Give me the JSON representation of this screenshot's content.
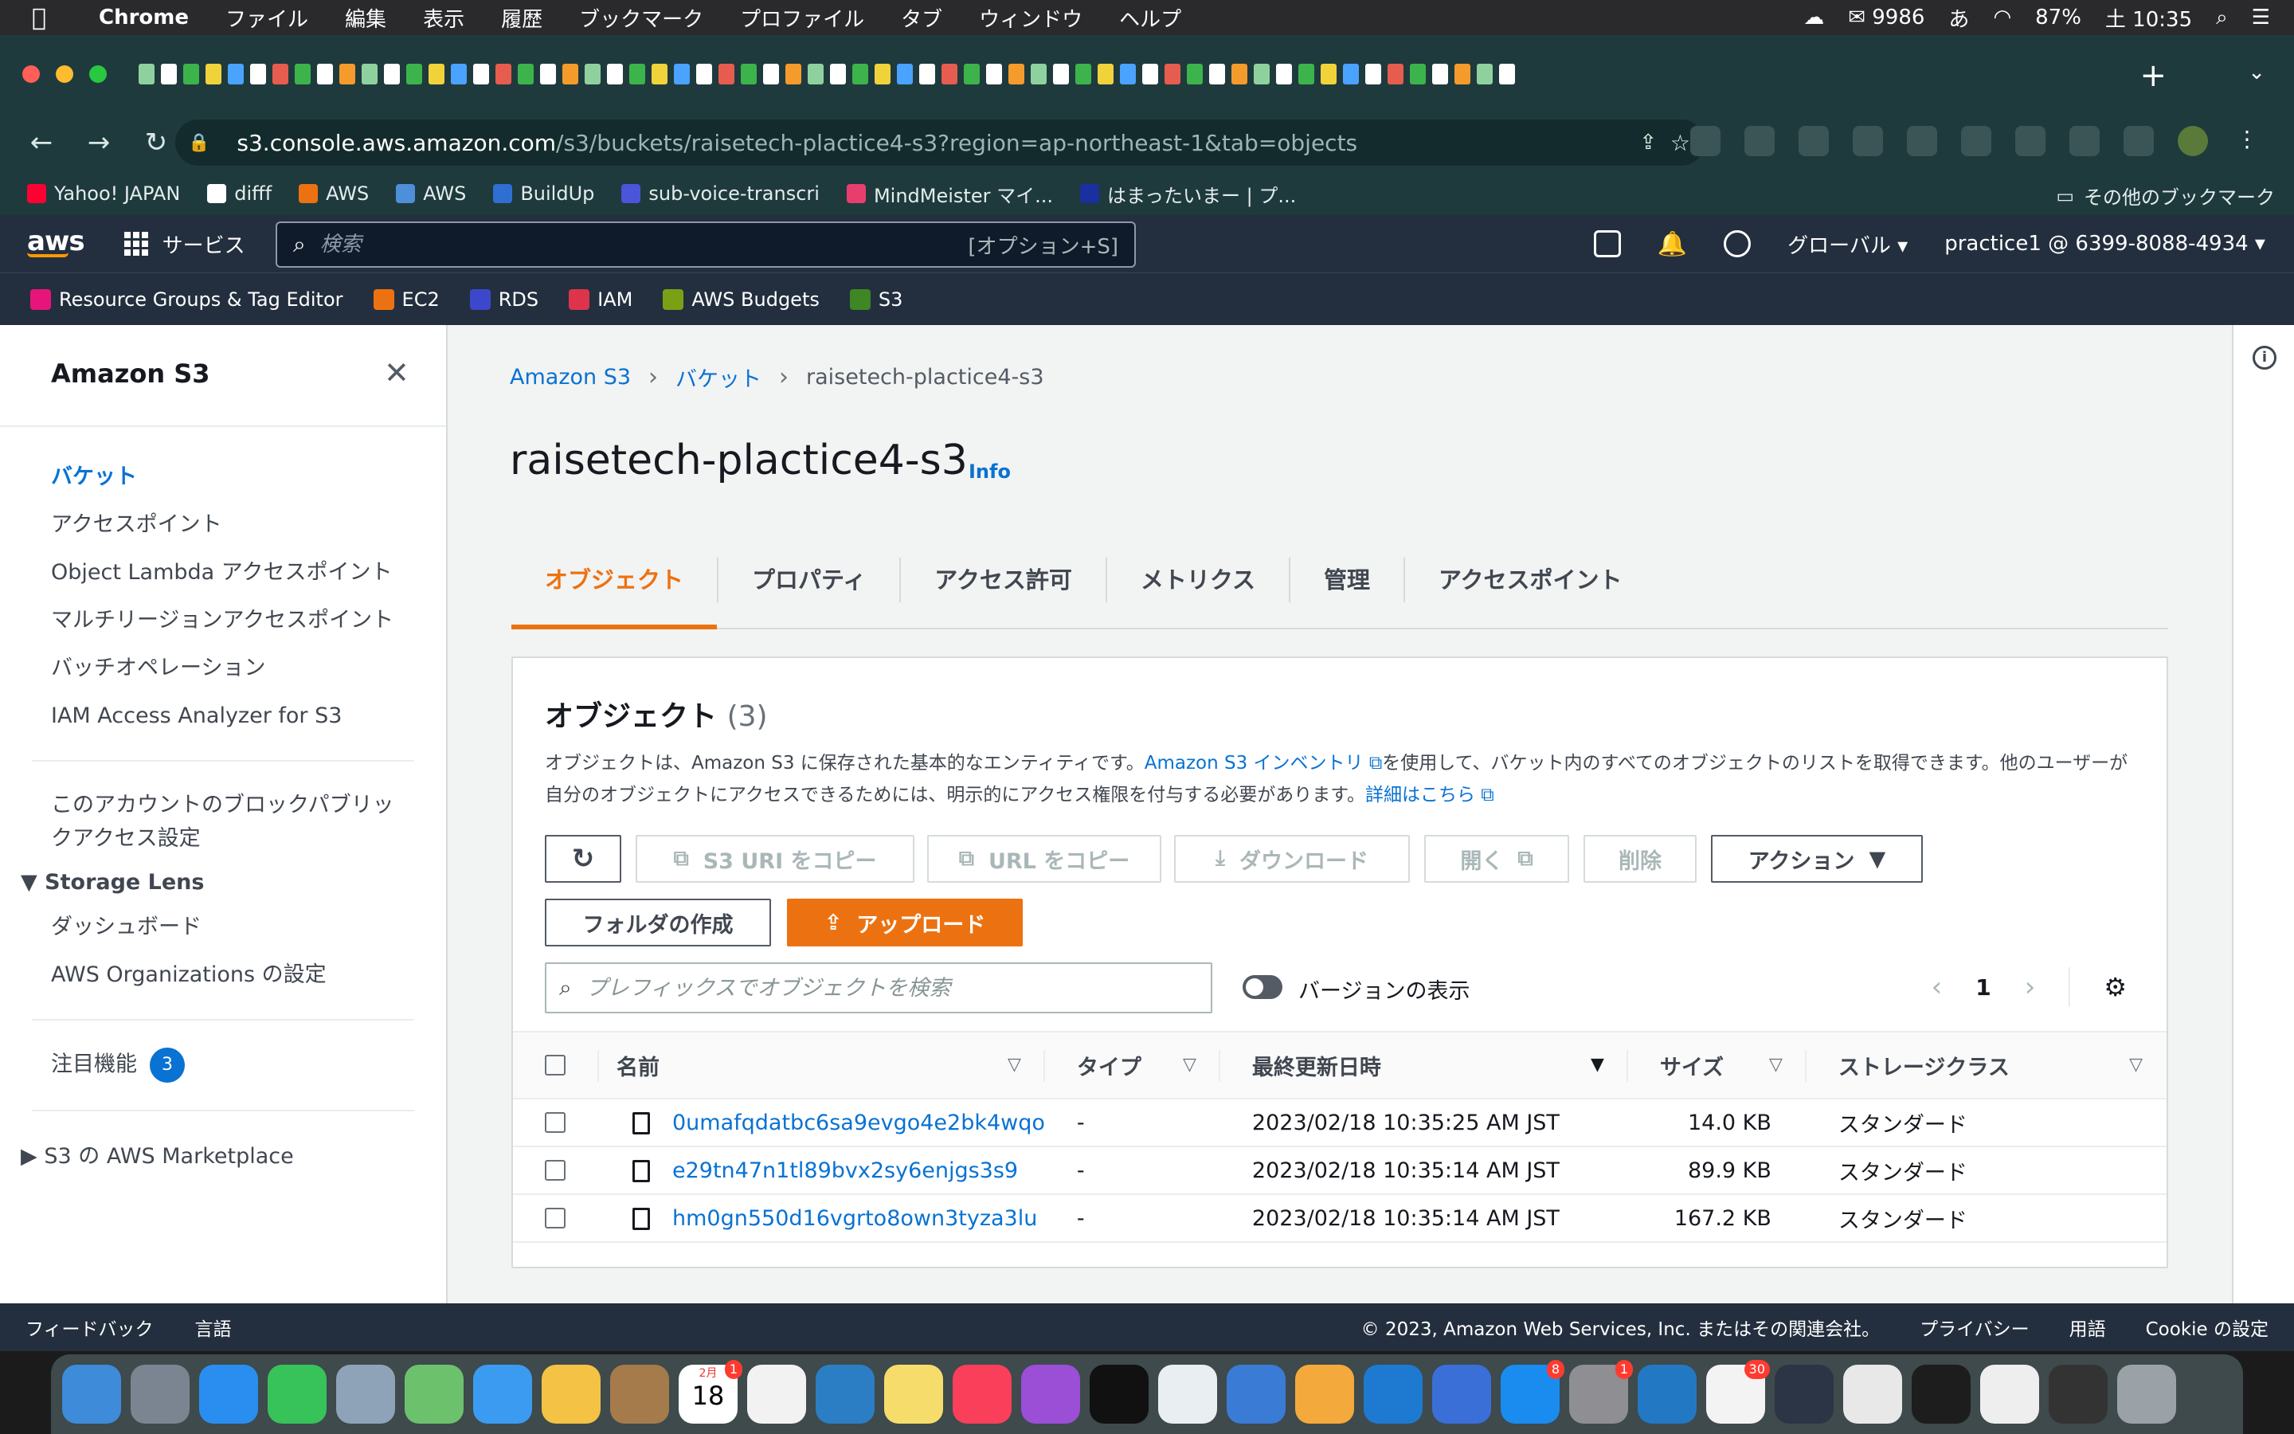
{
  "macos_menubar": {
    "app": "Chrome",
    "menus": [
      "ファイル",
      "編集",
      "表示",
      "履歴",
      "ブックマーク",
      "プロファイル",
      "タブ",
      "ウィンドウ",
      "ヘルプ"
    ],
    "status": {
      "mail_count": "9986",
      "input_method": "あ",
      "battery": "87%",
      "clock": "土 10:35"
    }
  },
  "browser": {
    "url_host": "s3.console.aws.amazon.com",
    "url_path": "/s3/buckets/raisetech-plactice4-s3?region=ap-northeast-1&tab=objects",
    "new_tab": "+",
    "bookmarks": [
      {
        "label": "Yahoo! JAPAN",
        "color": "#ff0033"
      },
      {
        "label": "difff",
        "color": "#ffffff"
      },
      {
        "label": "AWS",
        "color": "#ec7211"
      },
      {
        "label": "AWS",
        "color": "#4d8fd8"
      },
      {
        "label": "BuildUp",
        "color": "#2f6fd1"
      },
      {
        "label": "sub-voice-transcri",
        "color": "#4b55d9"
      },
      {
        "label": "MindMeister マイ...",
        "color": "#e83e6e"
      },
      {
        "label": "はまったいまー | プ...",
        "color": "#1a2fa0"
      }
    ],
    "other_bookmarks": "その他のブックマーク"
  },
  "aws_header": {
    "logo": "aws",
    "services": "サービス",
    "search_placeholder": "検索",
    "search_shortcut": "[オプション+S]",
    "region": "グローバル",
    "account": "practice1 @ 6399-8088-4934",
    "favorites": [
      {
        "label": "Resource Groups & Tag Editor",
        "color": "#e7157b"
      },
      {
        "label": "EC2",
        "color": "#ec7211"
      },
      {
        "label": "RDS",
        "color": "#3b48cc"
      },
      {
        "label": "IAM",
        "color": "#dd344c"
      },
      {
        "label": "AWS Budgets",
        "color": "#7aa116"
      },
      {
        "label": "S3",
        "color": "#3f8624"
      }
    ]
  },
  "sidebar": {
    "title": "Amazon S3",
    "items": [
      "バケット",
      "アクセスポイント",
      "Object Lambda アクセスポイント",
      "マルチリージョンアクセスポイント",
      "バッチオペレーション",
      "IAM Access Analyzer for S3"
    ],
    "block_public": "このアカウントのブロックパブリックアクセス設定",
    "storage_lens": "Storage Lens",
    "storage_items": [
      "ダッシュボード",
      "AWS Organizations の設定"
    ],
    "featured": "注目機能",
    "featured_count": "3",
    "marketplace": "S3 の AWS Marketplace"
  },
  "main": {
    "breadcrumbs": [
      "Amazon S3",
      "バケット",
      "raisetech-plactice4-s3"
    ],
    "title": "raisetech-plactice4-s3",
    "info": "Info",
    "tabs": [
      "オブジェクト",
      "プロパティ",
      "アクセス許可",
      "メトリクス",
      "管理",
      "アクセスポイント"
    ],
    "objects": {
      "heading": "オブジェクト",
      "count": "(3)",
      "desc_1": "オブジェクトは、Amazon S3 に保存された基本的なエンティティです。",
      "desc_link": "Amazon S3 インベントリ",
      "desc_2": "を使用して、バケット内のすべてのオブジェクトのリストを取得できます。他のユーザーが自分のオブジェクトにアクセスできるためには、明示的にアクセス権限を付与する必要があります。",
      "desc_link2": "詳細はこちら",
      "buttons": {
        "copy_uri": "S3 URI をコピー",
        "copy_url": "URL をコピー",
        "download": "ダウンロード",
        "open": "開く",
        "delete": "削除",
        "actions": "アクション",
        "create_folder": "フォルダの作成",
        "upload": "アップロード"
      },
      "search_placeholder": "プレフィックスでオブジェクトを検索",
      "versions": "バージョンの表示",
      "page": "1",
      "columns": [
        "名前",
        "タイプ",
        "最終更新日時",
        "サイズ",
        "ストレージクラス"
      ],
      "rows": [
        {
          "name": "0umafqdatbc6sa9evgo4e2bk4wqo",
          "type": "-",
          "modified": "2023/02/18 10:35:25 AM JST",
          "size": "14.0 KB",
          "class": "スタンダード"
        },
        {
          "name": "e29tn47n1tl89bvx2sy6enjgs3s9",
          "type": "-",
          "modified": "2023/02/18 10:35:14 AM JST",
          "size": "89.9 KB",
          "class": "スタンダード"
        },
        {
          "name": "hm0gn550d16vgrto8own3tyza3lu",
          "type": "-",
          "modified": "2023/02/18 10:35:14 AM JST",
          "size": "167.2 KB",
          "class": "スタンダード"
        }
      ]
    }
  },
  "footer": {
    "feedback": "フィードバック",
    "language": "言語",
    "copyright": "© 2023, Amazon Web Services, Inc. またはその関連会社。",
    "privacy": "プライバシー",
    "terms": "用語",
    "cookie": "Cookie の設定"
  },
  "dock": {
    "calendar_day": "18",
    "calendar_month": "2月",
    "badges": {
      "calendar": "1",
      "messages_app": "8",
      "settings": "1",
      "slack": "30"
    }
  }
}
